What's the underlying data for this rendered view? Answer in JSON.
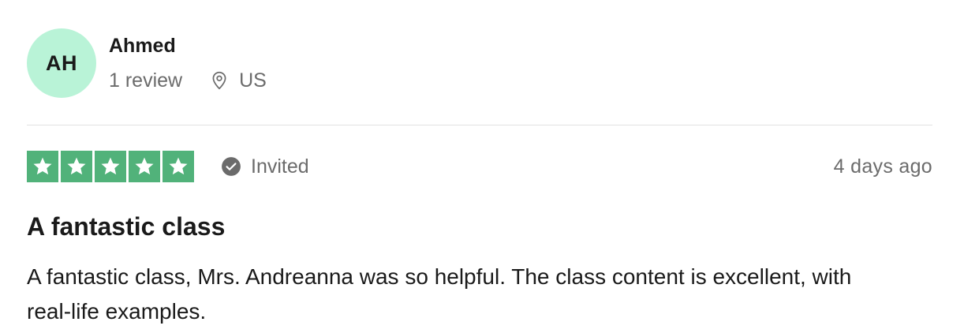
{
  "consumer": {
    "initials": "AH",
    "name": "Ahmed",
    "review_count": "1 review",
    "location": "US",
    "avatar_color": "#b9f3d7",
    "location_icon": "map-pin-icon"
  },
  "review": {
    "rating": 5,
    "rating_max": 5,
    "star_color": "#51b27a",
    "star_icon": "star-icon",
    "status": "Invited",
    "status_icon": "check-circle-icon",
    "date": "4 days ago",
    "title": "A fantastic class",
    "body": "A fantastic class, Mrs. Andreanna was so helpful. The class content is excellent, with real-life examples."
  }
}
